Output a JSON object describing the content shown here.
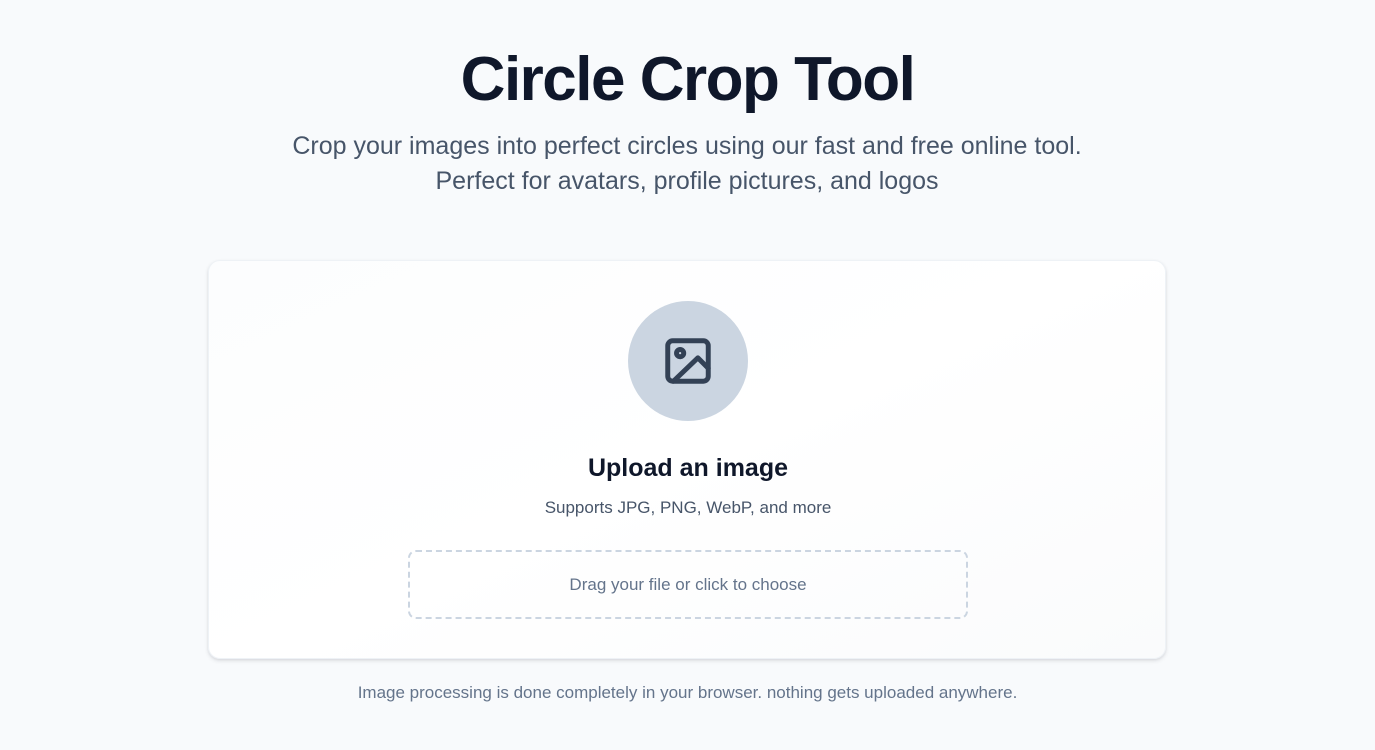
{
  "header": {
    "title": "Circle Crop Tool",
    "subtitle": "Crop your images into perfect circles using our fast and free online tool. Perfect for avatars, profile pictures, and logos"
  },
  "upload_card": {
    "icon": "image-icon",
    "title": "Upload an image",
    "supports": "Supports JPG, PNG, WebP, and more",
    "dropzone_label": "Drag your file or click to choose"
  },
  "footer": {
    "note": "Image processing is done completely in your browser. nothing gets uploaded anywhere."
  },
  "colors": {
    "background": "#f8fafc",
    "heading": "#0f172a",
    "muted": "#475569",
    "icon_circle": "#cbd5e1",
    "icon_stroke": "#334155",
    "dashed_border": "#cbd5e1"
  }
}
